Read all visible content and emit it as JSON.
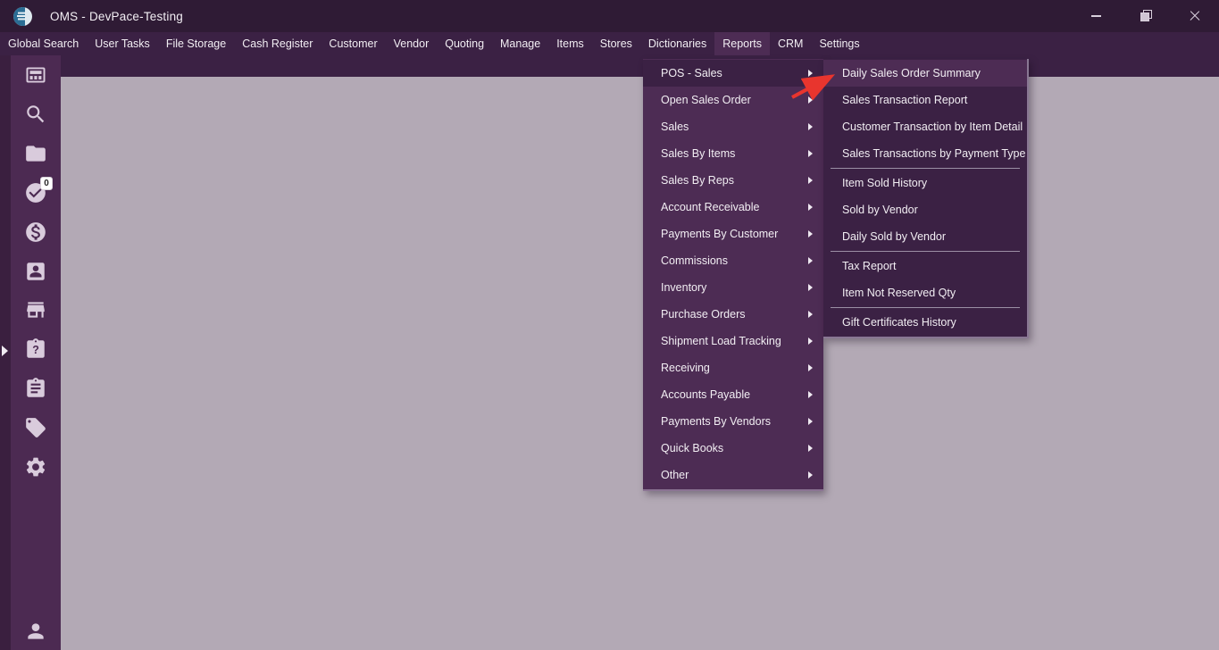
{
  "window": {
    "title": "OMS - DevPace-Testing",
    "app_icon": "oms-logo-icon",
    "controls": [
      {
        "name": "minimize-button",
        "icon": "minimize-icon"
      },
      {
        "name": "restore-button",
        "icon": "restore-icon"
      },
      {
        "name": "close-button",
        "icon": "close-icon"
      }
    ]
  },
  "menubar": {
    "items": [
      {
        "label": "Global Search"
      },
      {
        "label": "User Tasks"
      },
      {
        "label": "File Storage"
      },
      {
        "label": "Cash Register"
      },
      {
        "label": "Customer"
      },
      {
        "label": "Vendor"
      },
      {
        "label": "Quoting"
      },
      {
        "label": "Manage"
      },
      {
        "label": "Items"
      },
      {
        "label": "Stores"
      },
      {
        "label": "Dictionaries"
      },
      {
        "label": "Reports",
        "selected": true
      },
      {
        "label": "CRM"
      },
      {
        "label": "Settings"
      }
    ]
  },
  "reports_menu": {
    "items": [
      {
        "label": "POS - Sales",
        "open": true
      },
      {
        "label": "Open Sales Order"
      },
      {
        "label": "Sales"
      },
      {
        "label": "Sales By Items"
      },
      {
        "label": "Sales By Reps"
      },
      {
        "label": "Account Receivable"
      },
      {
        "label": "Payments By Customer"
      },
      {
        "label": "Commissions"
      },
      {
        "label": "Inventory"
      },
      {
        "label": "Purchase Orders"
      },
      {
        "label": "Shipment Load Tracking"
      },
      {
        "label": "Receiving"
      },
      {
        "label": "Accounts Payable"
      },
      {
        "label": "Payments By Vendors"
      },
      {
        "label": "Quick Books"
      },
      {
        "label": "Other"
      }
    ]
  },
  "pos_sales_submenu": {
    "entries": [
      {
        "type": "item",
        "label": "Daily Sales Order Summary",
        "highlighted": true
      },
      {
        "type": "item",
        "label": "Sales Transaction Report"
      },
      {
        "type": "item",
        "label": "Customer Transaction by Item Detail"
      },
      {
        "type": "item",
        "label": "Sales Transactions by Payment Type"
      },
      {
        "type": "separator"
      },
      {
        "type": "item",
        "label": "Item Sold History"
      },
      {
        "type": "item",
        "label": "Sold by Vendor"
      },
      {
        "type": "item",
        "label": "Daily Sold by Vendor"
      },
      {
        "type": "separator"
      },
      {
        "type": "item",
        "label": "Tax Report"
      },
      {
        "type": "item",
        "label": "Item Not Reserved Qty"
      },
      {
        "type": "separator"
      },
      {
        "type": "item",
        "label": "Gift Certificates History"
      }
    ]
  },
  "sidebar": {
    "icons": [
      {
        "name": "pos-terminal-icon"
      },
      {
        "name": "search-icon"
      },
      {
        "name": "folder-icon"
      },
      {
        "name": "check-circle-icon",
        "badge": "0"
      },
      {
        "name": "dollar-circle-icon"
      },
      {
        "name": "contact-card-icon"
      },
      {
        "name": "store-icon"
      },
      {
        "name": "clipboard-question-icon"
      },
      {
        "name": "clipboard-tasks-icon"
      },
      {
        "name": "tag-icon"
      },
      {
        "name": "settings-gear-icon"
      }
    ],
    "bottom_icon": {
      "name": "person-icon"
    },
    "flyout_icon": {
      "name": "flyout-arrow-icon"
    }
  },
  "annotation": {
    "arrow_color": "#E8352E"
  },
  "colors": {
    "titlebar": "#2F1B35",
    "menubar": "#3B2144",
    "panel": "#4D2C54",
    "sidebar": "#4C2A52",
    "strip": "#3A1F3F",
    "content": "#B3A9B5",
    "icon": "#D9CBDC",
    "separator": "#9B8FA5",
    "text": "#F2EEF3"
  }
}
